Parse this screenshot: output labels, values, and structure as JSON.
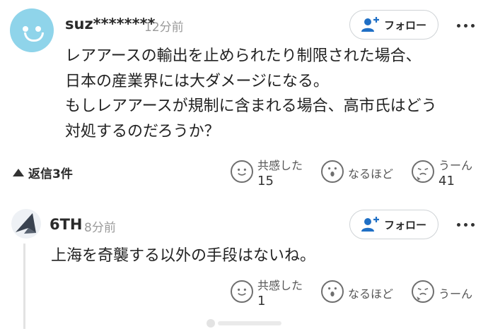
{
  "comments": [
    {
      "username": "suz********",
      "time": "12分前",
      "follow_label": "フォロー",
      "text_lines": [
        "レアアースの輸出を止められたり制限された場合、",
        "日本の産業界には大ダメージになる。",
        "もしレアアースが規制に含まれる場合、高市氏はどう",
        "対処するのだろうか？"
      ],
      "replies_label": "返信3件",
      "reactions": {
        "empathy": {
          "label": "共感した",
          "count": "15"
        },
        "insight": {
          "label": "なるほど"
        },
        "hmm": {
          "label": "うーん",
          "count": "41"
        }
      }
    },
    {
      "username": "6TH",
      "time": "8分前",
      "follow_label": "フォロー",
      "text_lines": [
        "上海を奇襲する以外の手段はないね。"
      ],
      "reactions": {
        "empathy": {
          "label": "共感した",
          "count": "1"
        },
        "insight": {
          "label": "なるほど"
        },
        "hmm": {
          "label": "うーん"
        }
      }
    }
  ],
  "colors": {
    "avatar": "#8fd4ea",
    "icon_blue": "#1f6fc5",
    "text": "#222222",
    "muted": "#9a9a9a"
  },
  "icons": [
    "smile-face-icon",
    "surprised-face-icon",
    "sweat-face-icon",
    "add-user-icon",
    "more-options-icon"
  ]
}
